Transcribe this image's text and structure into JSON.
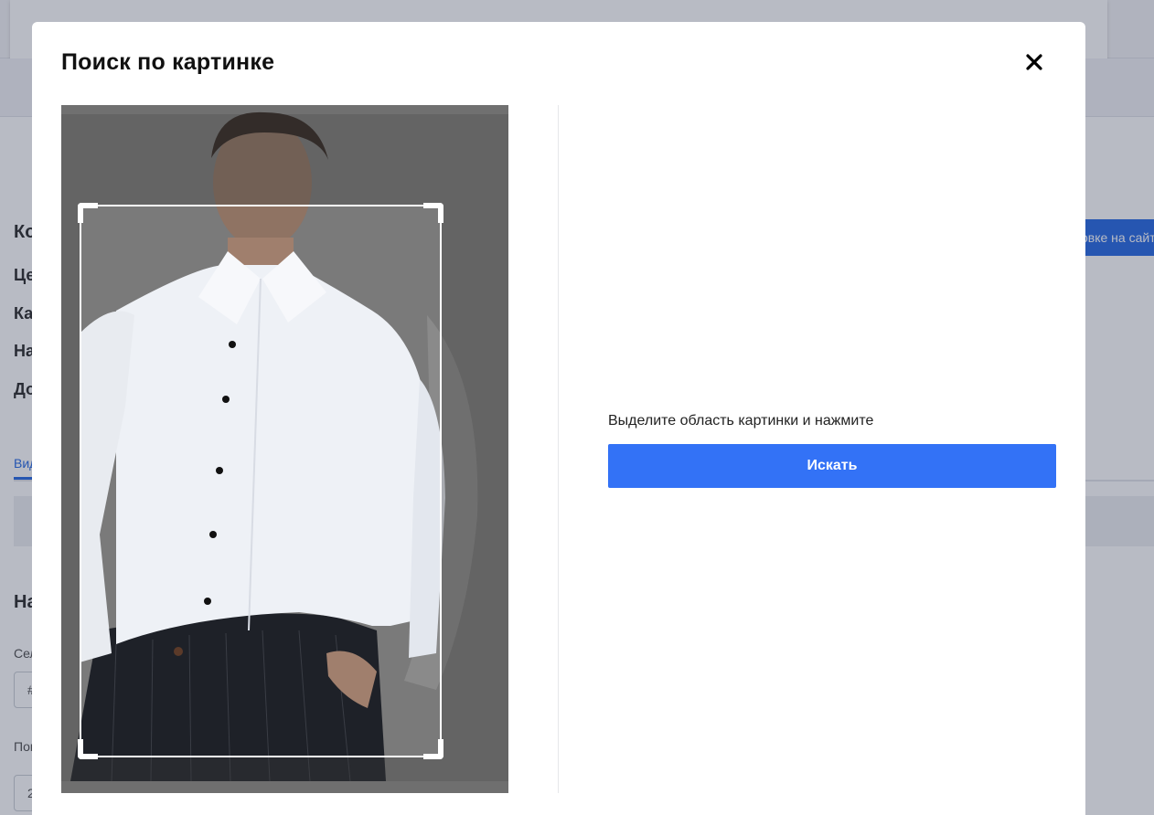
{
  "background": {
    "heading_partial": "Ко",
    "rows_partial": [
      "Це",
      "Ка",
      "На",
      "До"
    ],
    "tab_partial": "Вид",
    "section_partial": "На",
    "field_label_1": "Сел",
    "field_value_1": "#",
    "field_label_2": "Пои",
    "field_value_2": "2",
    "side_button_partial": "овке на сайт"
  },
  "modal": {
    "title": "Поиск по картинке",
    "close_icon": "close-icon",
    "hint": "Выделите область картинки и нажмите",
    "search_button": "Искать"
  },
  "colors": {
    "accent": "#3372f6",
    "crop_frame": "#ffffff"
  }
}
